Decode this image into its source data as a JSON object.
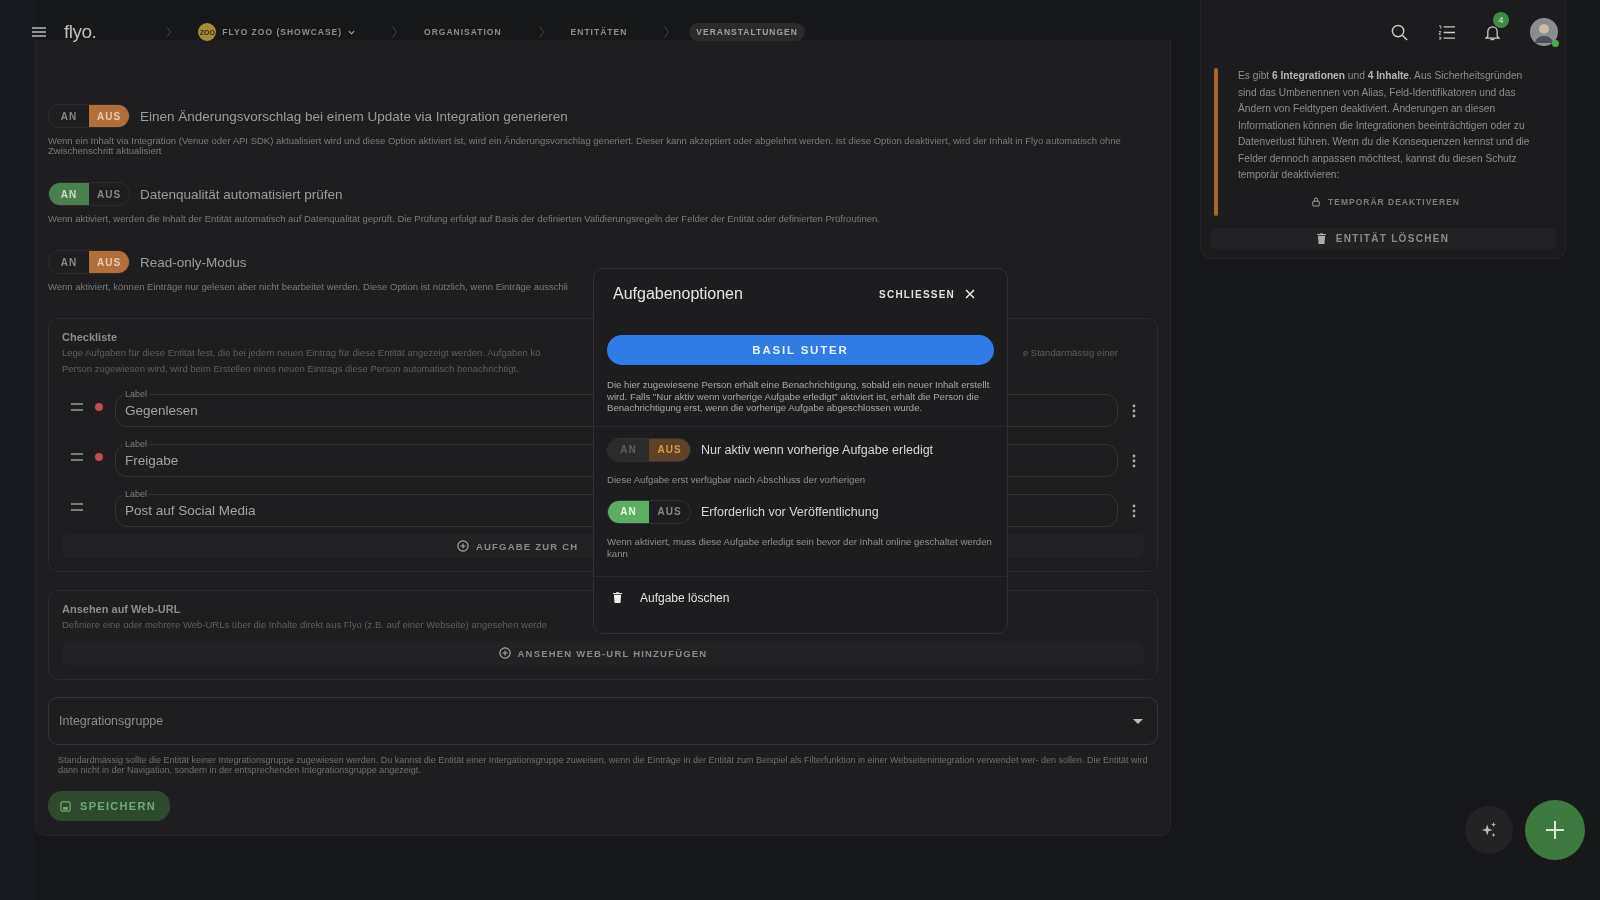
{
  "topbar": {
    "logo": "flyo.",
    "breadcrumbs": [
      {
        "label": "FLYO ZOO (SHOWCASE)",
        "kind": "org",
        "badge": "ZOO",
        "selected": false
      },
      {
        "label": "ORGANISATION",
        "kind": "plain",
        "selected": false
      },
      {
        "label": "ENTITÄTEN",
        "kind": "plain",
        "selected": false
      },
      {
        "label": "VERANSTALTUNGEN",
        "kind": "plain",
        "selected": true
      }
    ],
    "notification_count": "4"
  },
  "settings": [
    {
      "on_label": "AN",
      "off_label": "AUS",
      "on": false,
      "label": "Einen Änderungsvorschlag bei einem Update via Integration generieren",
      "description": "Wenn ein Inhalt via Integration (Venue oder API SDK) aktualisiert wird und diese Option aktiviert ist, wird ein Änderungsvorschlag generiert. Dieser kann akzeptiert oder abgelehnt werden. Ist diese Option deaktiviert, wird der Inhalt in Flyo automatisch ohne Zwischenschritt aktualisiert"
    },
    {
      "on_label": "AN",
      "off_label": "AUS",
      "on": true,
      "label": "Datenqualität automatisiert prüfen",
      "description": "Wenn aktiviert, werden die Inhalt der Entität automatisch auf Datenqualität geprüft. Die Prüfung erfolgt auf Basis der definierten Validierungsregeln der Felder der Entität oder definierten Prüfroutinen."
    },
    {
      "on_label": "AN",
      "off_label": "AUS",
      "on": false,
      "label": "Read-only-Modus",
      "description": "Wenn aktiviert, können Einträge nur gelesen aber nicht bearbeitet werden. Diese Option ist nützlich, wenn Einträge ausschli"
    }
  ],
  "checklist": {
    "title": "Checkliste",
    "description_start": "Lege Aufgaben für diese Entität fest, die bei jedem neuen Eintrag für diese Entität angezeigt werden. Aufgaben kö",
    "description_end": "e Standarmässig einer",
    "description_line2": "Person zugewiesen wird, wird beim Erstellen eines neuen Eintrags diese Person automatisch benachrichtigt.",
    "tasks": [
      {
        "field_label": "Label",
        "value": "Gegenlesen",
        "flagged": true
      },
      {
        "field_label": "Label",
        "value": "Freigabe",
        "flagged": true
      },
      {
        "field_label": "Label",
        "value": "Post auf Social Media",
        "flagged": false
      }
    ],
    "add_button": "AUFGABE ZUR CH"
  },
  "web_url": {
    "title": "Ansehen auf Web-URL",
    "description": "Definiere eine oder mehrere Web-URLs über die Inhalte direkt aus Flyo (z.B. auf einer Webseite) angesehen werde",
    "add_button": "ANSEHEN WEB-URL HINZUFÜGEN"
  },
  "integration_group": {
    "placeholder": "Integrationsgruppe",
    "help": "Standardmässig sollte die Entität keiner Integrationsgruppe zugewiesen werden. Du kannst die Entität einer Intergationsgruppe zuweisen, wenn die Einträge in der Entität zum Beispiel als Filterfunktion in einer Webseitenintegration verwendet wer- den sollen. Die Entität wird dann nicht in der Navigation, sondern in der entsprechenden Integrationsgruppe angezeigt."
  },
  "save_button": "SPEICHERN",
  "side_panel": {
    "notice": "Es gibt **6 Integrationen** und **4 Inhalte**. Aus Sicherheitsgründen sind das Umbenennen von Alias, Feld-Identifikatoren und das Ändern von Feldtypen deaktiviert. Änderungen an diesen Informationen können die Integrationen beeinträchtigen oder zu Datenverlust führen. Wenn du die Konsequenzen kennst und die Felder dennoch anpassen möchtest, kannst du diesen Schutz temporär deaktivieren:",
    "unlock_button": "TEMPORÄR DEAKTIVEREN",
    "delete_button": "ENTITÄT LÖSCHEN"
  },
  "dialog": {
    "title": "Aufgabenoptionen",
    "close_label": "SCHLIESSEN",
    "assignee_button": "BASIL SUTER",
    "info": "Die hier zugewiesene Person erhält eine Benachrichtigung, sobald ein neuer Inhalt erstellt wird. Falls \"Nur aktiv wenn vorherige Aufgabe erledigt\" aktiviert ist, erhält die Person die Benachrichtigung erst, wenn die vorherige Aufgabe abgeschlossen wurde.",
    "options": [
      {
        "on_label": "AN",
        "off_label": "AUS",
        "on": false,
        "disabled": true,
        "label": "Nur aktiv wenn vorherige Aufgabe erledigt",
        "description": "Diese Aufgabe erst verfügbar nach Abschluss der vorherigen"
      },
      {
        "on_label": "AN",
        "off_label": "AUS",
        "on": true,
        "disabled": false,
        "label": "Erforderlich vor Veröffentlichung",
        "description": "Wenn aktiviert, muss diese Aufgabe erledigt sein bevor der Inhalt online geschaltet werden kann"
      }
    ],
    "delete_label": "Aufgabe löschen"
  }
}
